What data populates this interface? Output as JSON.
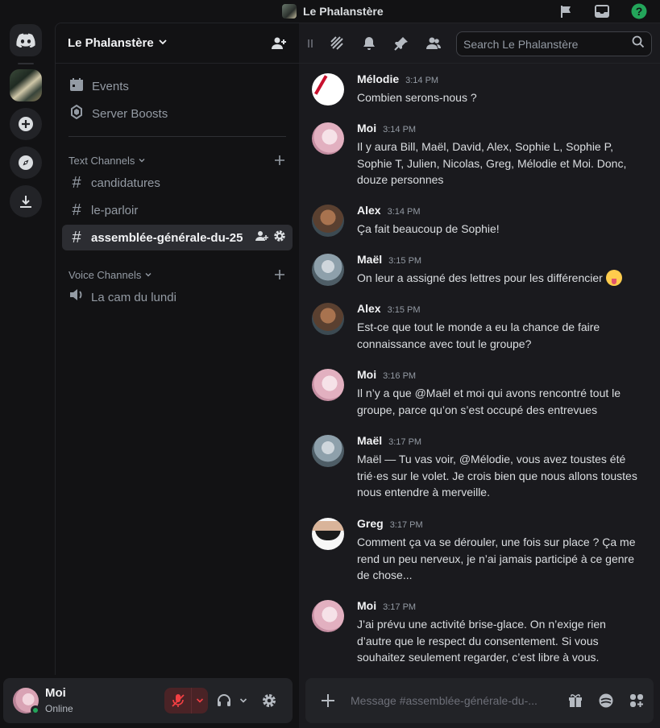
{
  "window": {
    "title": "Le Phalanstère",
    "icons": [
      "inbox-flag-icon",
      "inbox-icon",
      "help-icon"
    ],
    "help_color": "#23a55a"
  },
  "rail": {
    "items": [
      "discord-home-icon",
      "server-le-phalanstere",
      "add-server-icon",
      "explore-icon",
      "download-icon"
    ]
  },
  "guild": {
    "name": "Le Phalanstère",
    "top_items": [
      {
        "label": "Events",
        "icon": "calendar-icon"
      },
      {
        "label": "Server Boosts",
        "icon": "boost-icon"
      }
    ],
    "categories": [
      {
        "label": "Text Channels"
      },
      {
        "label": "Voice Channels"
      }
    ],
    "text_channels": [
      {
        "name": "candidatures"
      },
      {
        "name": "le-parloir"
      },
      {
        "name": "assemblée-générale-du-25",
        "active": true
      }
    ],
    "voice_channels": [
      {
        "name": "La cam du lundi"
      }
    ]
  },
  "user": {
    "name": "Moi",
    "status": "Online",
    "status_color": "#23a55a",
    "muted": true
  },
  "search": {
    "placeholder": "Search Le Phalanstère"
  },
  "messages": [
    {
      "author": "Mélodie",
      "time": "3:14 PM",
      "text": "Combien serons-nous ?"
    },
    {
      "author": "Moi",
      "time": "3:14 PM",
      "text": "Il y aura Bill, Maël, David, Alex, Sophie L, Sophie P, Sophie T, Julien, Nicolas, Greg, Mélodie et Moi. Donc, douze personnes"
    },
    {
      "author": "Alex",
      "time": "3:14 PM",
      "text": "Ça fait beaucoup de Sophie!"
    },
    {
      "author": "Maël",
      "time": "3:15 PM",
      "text": "On leur a assigné des lettres pour les différencier",
      "emoji": "squinting-tongue-emoji"
    },
    {
      "author": "Alex",
      "time": "3:15 PM",
      "text": "Est-ce que tout le monde a eu la chance de faire connaissance avec tout le groupe?"
    },
    {
      "author": "Moi",
      "time": "3:16 PM",
      "text": "Il n’y a que @Maël et moi qui avons rencontré tout le groupe, parce qu’on s’est occupé des entrevues"
    },
    {
      "author": "Maël",
      "time": "3:17 PM",
      "text": "Maël — Tu vas voir, @Mélodie, vous avez toustes été trié·es sur le volet. Je crois bien que nous allons toustes nous entendre à merveille."
    },
    {
      "author": "Greg",
      "time": "3:17 PM",
      "text": "Comment ça va se dérouler, une fois sur place ? Ça me rend un peu nerveux, je n’ai jamais participé à ce genre de chose..."
    },
    {
      "author": "Moi",
      "time": "3:17 PM",
      "text": "J’ai prévu une activité brise-glace. On n’exige rien d’autre que le respect du consentement. Si vous souhaitez seulement regarder, c’est libre à vous."
    }
  ],
  "composer": {
    "placeholder": "Message #assemblée-générale-du-..."
  }
}
